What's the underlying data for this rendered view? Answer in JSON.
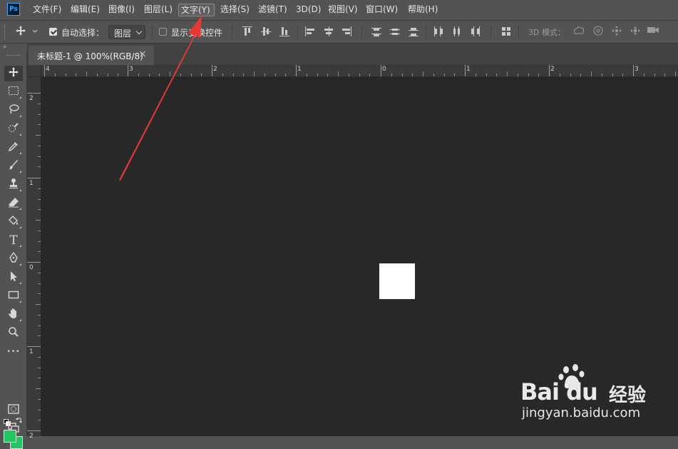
{
  "app": {
    "logo_text": "Ps"
  },
  "menu": [
    {
      "label": "文件(F)"
    },
    {
      "label": "编辑(E)"
    },
    {
      "label": "图像(I)"
    },
    {
      "label": "图层(L)"
    },
    {
      "label": "文字(Y)",
      "active": true
    },
    {
      "label": "选择(S)"
    },
    {
      "label": "滤镜(T)"
    },
    {
      "label": "3D(D)"
    },
    {
      "label": "视图(V)"
    },
    {
      "label": "窗口(W)"
    },
    {
      "label": "帮助(H)"
    }
  ],
  "options": {
    "auto_select_label": "自动选择：",
    "auto_select_checked": true,
    "auto_select_target": "图层",
    "show_transform_label": "显示变换控件",
    "show_transform_checked": false,
    "mode_3d_label": "3D 模式："
  },
  "collapse_glyph": "»",
  "document": {
    "tab_title": "未标题-1 @ 100%(RGB/8)",
    "close_glyph": "×"
  },
  "ruler_top_labels": [
    "4",
    "3",
    "2",
    "1",
    "0",
    "1",
    "2",
    "3"
  ],
  "ruler_left_labels": [
    "2",
    "1",
    "0",
    "1",
    "2"
  ],
  "tools": [
    {
      "name": "move-tool",
      "icon": "move-icon",
      "active": true
    },
    {
      "name": "marquee-tool",
      "icon": "marquee-icon"
    },
    {
      "name": "lasso-tool",
      "icon": "lasso-icon"
    },
    {
      "name": "quick-select-tool",
      "icon": "quick-select-icon"
    },
    {
      "name": "eyedropper-tool",
      "icon": "eyedropper-icon"
    },
    {
      "name": "brush-tool",
      "icon": "brush-icon"
    },
    {
      "name": "stamp-tool",
      "icon": "stamp-icon"
    },
    {
      "name": "eraser-tool",
      "icon": "eraser-icon"
    },
    {
      "name": "paint-bucket-tool",
      "icon": "paint-bucket-icon"
    },
    {
      "name": "type-tool",
      "icon": "type-icon",
      "glyph": "T"
    },
    {
      "name": "pen-tool",
      "icon": "pen-icon"
    },
    {
      "name": "path-select-tool",
      "icon": "arrow-cursor-icon"
    },
    {
      "name": "rectangle-tool",
      "icon": "rectangle-icon"
    },
    {
      "name": "hand-tool",
      "icon": "hand-icon"
    },
    {
      "name": "zoom-tool",
      "icon": "zoom-icon"
    },
    {
      "name": "more-tools",
      "icon": "more-icon",
      "glyph": "•••"
    }
  ],
  "colors": {
    "foreground": "#22c55e",
    "background": "#22c55e",
    "canvas_bg": "#282828",
    "document_fill": "#ffffff",
    "arrow": "#e53935"
  },
  "watermark": {
    "brand": "Bai du",
    "suffix": "经验",
    "url": "jingyan.baidu.com"
  }
}
